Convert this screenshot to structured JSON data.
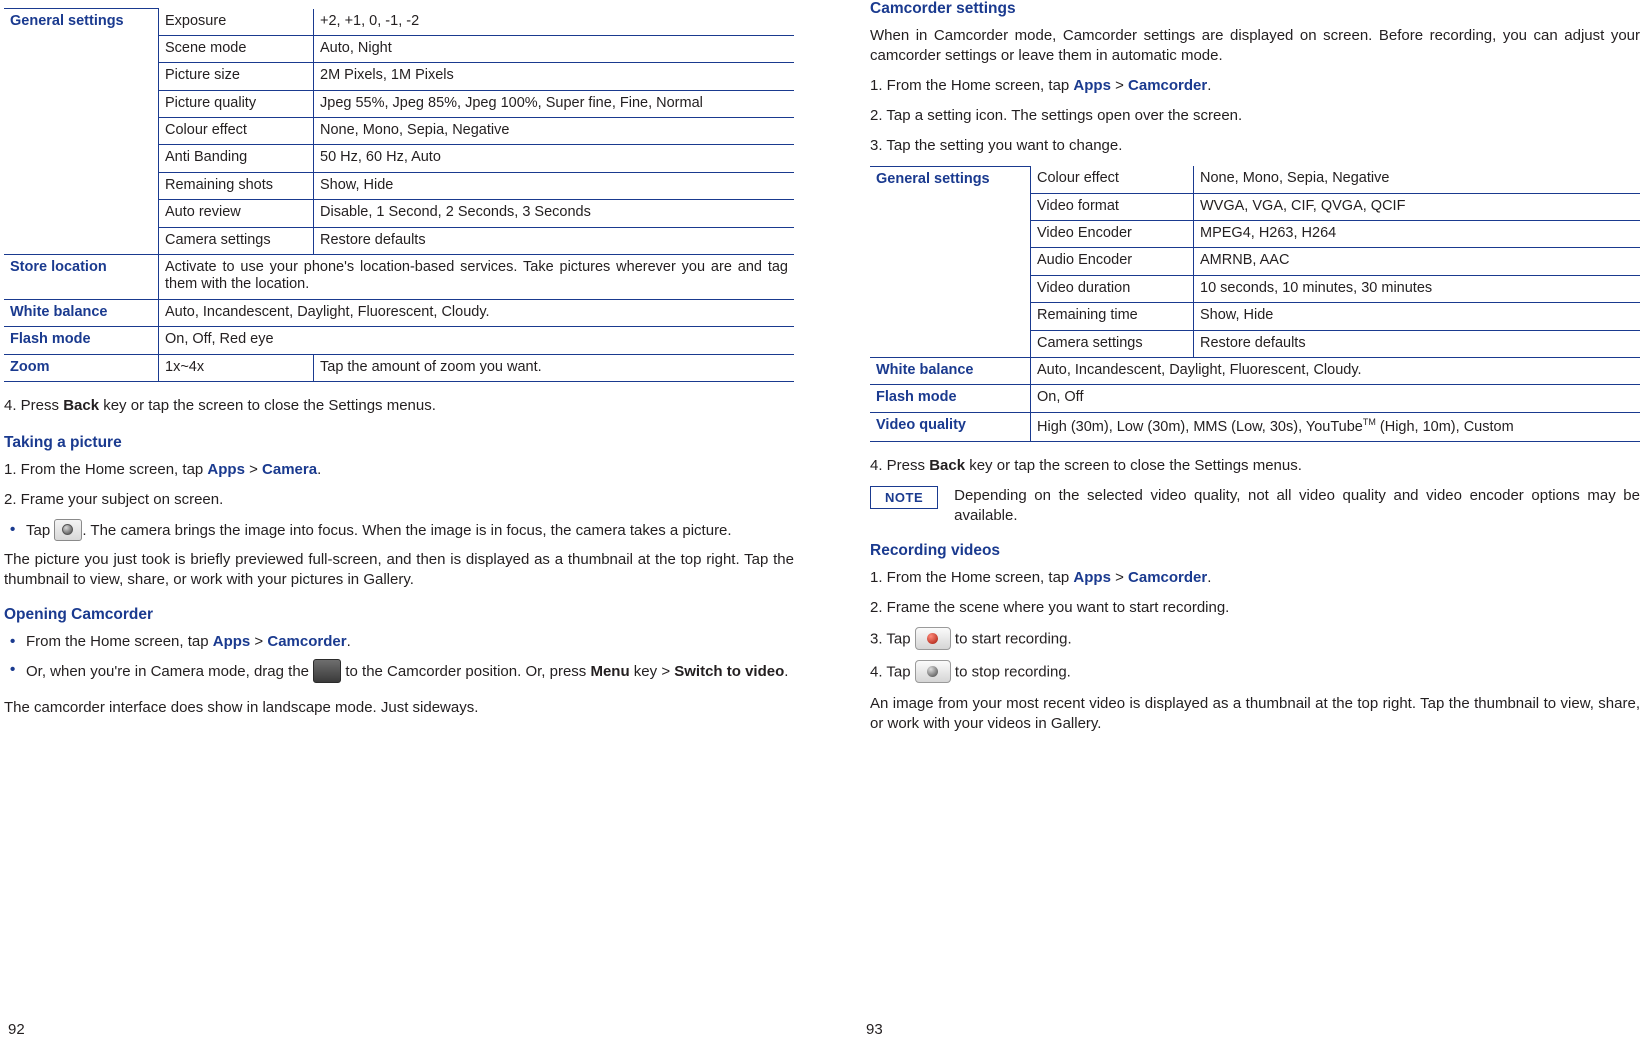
{
  "left_page": {
    "number": "92",
    "camera_settings_table": {
      "rows": [
        {
          "group": "General settings",
          "setting": "Exposure",
          "value": "+2, +1, 0, -1, -2"
        },
        {
          "group": "",
          "setting": "Scene mode",
          "value": "Auto, Night"
        },
        {
          "group": "",
          "setting": "Picture size",
          "value": "2M Pixels, 1M Pixels"
        },
        {
          "group": "",
          "setting": "Picture quality",
          "value": "Jpeg 55%, Jpeg 85%, Jpeg 100%, Super fine, Fine, Normal"
        },
        {
          "group": "",
          "setting": "Colour effect",
          "value": "None, Mono, Sepia, Negative"
        },
        {
          "group": "",
          "setting": "Anti Banding",
          "value": "50 Hz, 60 Hz, Auto"
        },
        {
          "group": "",
          "setting": "Remaining shots",
          "value": "Show, Hide"
        },
        {
          "group": "",
          "setting": "Auto review",
          "value": "Disable, 1 Second, 2 Seconds, 3 Seconds"
        },
        {
          "group": "",
          "setting": "Camera settings",
          "value": "Restore defaults"
        }
      ],
      "store_location_label": "Store location",
      "store_location_value": "Activate to use your phone's location-based services. Take pictures wherever you are and tag them with the location.",
      "white_balance_label": "White balance",
      "white_balance_value": "Auto, Incandescent, Daylight, Fluorescent, Cloudy.",
      "flash_mode_label": "Flash mode",
      "flash_mode_value": "On, Off, Red eye",
      "zoom_label": "Zoom",
      "zoom_range": "1x~4x",
      "zoom_value": "Tap the amount of zoom you want."
    },
    "step4_pre": "4. Press ",
    "step4_bold": "Back",
    "step4_post": " key or tap the screen to close the Settings menus.",
    "taking_picture_heading": "Taking a picture",
    "tp_step1_pre": "1. From the Home screen, tap ",
    "tp_step1_b1": "Apps",
    "tp_step1_mid": " > ",
    "tp_step1_b2": "Camera",
    "tp_step1_post": ".",
    "tp_step2": "2. Frame your subject on screen.",
    "tp_bullet_pre": "Tap ",
    "tp_bullet_post": ". The camera brings the image into focus. When the image is in focus, the camera takes a picture.",
    "tp_para": "The picture you just took is briefly previewed full-screen, and then is displayed as a thumbnail at the top right. Tap the thumbnail to view, share, or work with your pictures in Gallery.",
    "opening_camcorder_heading": "Opening Camcorder",
    "oc_b1_pre": "From the Home screen, tap ",
    "oc_b1_apps": "Apps",
    "oc_b1_mid": " > ",
    "oc_b1_camcorder": "Camcorder",
    "oc_b1_post": ".",
    "oc_b2_pre": "Or, when you're in Camera mode, drag the ",
    "oc_b2_mid": " to the Camcorder position. Or, press ",
    "oc_b2_menu": "Menu",
    "oc_b2_key": " key > ",
    "oc_b2_switch": "Switch to video",
    "oc_b2_post": ".",
    "oc_para": "The camcorder interface does show in landscape mode. Just sideways."
  },
  "right_page": {
    "number": "93",
    "heading": "Camcorder settings",
    "intro": "When in Camcorder mode, Camcorder settings are displayed on screen. Before recording, you can adjust your camcorder settings or leave them in automatic mode.",
    "step1_pre": "1. From the Home screen, tap ",
    "step1_b1": "Apps",
    "step1_mid": " > ",
    "step1_b2": "Camcorder",
    "step1_post": ".",
    "step2": "2. Tap a setting icon. The settings open over the screen.",
    "step3": "3. Tap the setting you want to change.",
    "camcorder_settings_table": {
      "rows": [
        {
          "group": "General settings",
          "setting": "Colour effect",
          "value": "None, Mono, Sepia, Negative"
        },
        {
          "group": "",
          "setting": "Video format",
          "value": "WVGA, VGA, CIF, QVGA, QCIF"
        },
        {
          "group": "",
          "setting": "Video Encoder",
          "value": "MPEG4, H263, H264"
        },
        {
          "group": "",
          "setting": "Audio Encoder",
          "value": "AMRNB, AAC"
        },
        {
          "group": "",
          "setting": "Video duration",
          "value": "10 seconds, 10 minutes, 30 minutes"
        },
        {
          "group": "",
          "setting": "Remaining time",
          "value": "Show, Hide"
        },
        {
          "group": "",
          "setting": "Camera settings",
          "value": "Restore defaults"
        }
      ],
      "white_balance_label": "White balance",
      "white_balance_value": "Auto, Incandescent, Daylight, Fluorescent, Cloudy.",
      "flash_mode_label": "Flash mode",
      "flash_mode_value": "On, Off",
      "video_quality_label": "Video quality",
      "video_quality_value_pre": "High (30m), Low (30m), MMS (Low, 30s), YouTube",
      "video_quality_tm": "TM",
      "video_quality_value_post": " (High, 10m), Custom"
    },
    "step4_pre": "4. Press ",
    "step4_bold": "Back",
    "step4_post": " key or tap the screen to close the Settings menus.",
    "note_label": "NOTE",
    "note_text": "Depending on the selected video quality, not all video quality and video encoder options may be available.",
    "recording_heading": "Recording videos",
    "rec_step1_pre": "1. From the Home screen, tap ",
    "rec_step1_b1": "Apps",
    "rec_step1_mid": " > ",
    "rec_step1_b2": "Camcorder",
    "rec_step1_post": ".",
    "rec_step2": "2. Frame the scene where you want to start recording.",
    "rec_step3_pre": "3. Tap ",
    "rec_step3_post": " to start recording.",
    "rec_step4_pre": "4. Tap ",
    "rec_step4_post": " to stop recording.",
    "rec_para": "An image from your most recent video is displayed as a thumbnail at the top right. Tap the thumbnail to view, share, or work with your videos in Gallery."
  },
  "colors": {
    "accent": "#1a3a8f",
    "text": "#231f20"
  }
}
